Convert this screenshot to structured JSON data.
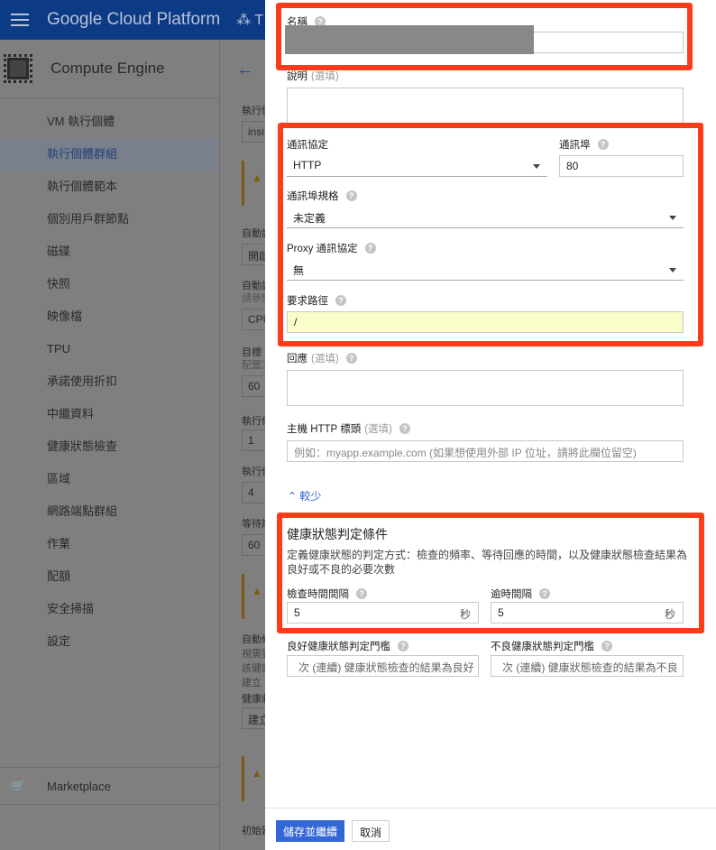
{
  "header": {
    "title": "Google Cloud Platform",
    "project": "T"
  },
  "sidebar": {
    "product": "Compute Engine",
    "items": [
      {
        "label": "VM 執行個體"
      },
      {
        "label": "執行個體群組",
        "selected": true
      },
      {
        "label": "執行個體範本"
      },
      {
        "label": "個別用戶群節點"
      },
      {
        "label": "磁碟"
      },
      {
        "label": "快照"
      },
      {
        "label": "映像檔"
      },
      {
        "label": "TPU"
      },
      {
        "label": "承諾使用折扣"
      },
      {
        "label": "中繼資料"
      },
      {
        "label": "健康狀態檢查"
      },
      {
        "label": "區域"
      },
      {
        "label": "網路端點群組"
      },
      {
        "label": "作業"
      },
      {
        "label": "配額"
      },
      {
        "label": "安全掃描"
      },
      {
        "label": "設定"
      }
    ],
    "marketplace": "Marketplace"
  },
  "background": {
    "labels": [
      "執行個",
      "自動調",
      "自動調",
      "請參閱",
      "目標",
      "配置工",
      "執行個",
      "執行個",
      "等待期",
      "自動修",
      "視需要",
      "該健康",
      "建立",
      "健康狀",
      "初始延"
    ],
    "values": [
      "insi",
      "開啟",
      "CPU",
      "60",
      "1",
      "4",
      "60",
      "建立"
    ]
  },
  "form": {
    "name": {
      "label": "名稱"
    },
    "description": {
      "label": "說明",
      "optional": "(選填)",
      "value": ""
    },
    "protocol": {
      "label": "通訊協定",
      "value": "HTTP"
    },
    "port": {
      "label": "通訊埠",
      "value": "80"
    },
    "port_spec": {
      "label": "通訊埠規格",
      "value": "未定義"
    },
    "proxy": {
      "label": "Proxy 通訊協定",
      "value": "無"
    },
    "path": {
      "label": "要求路徑",
      "value": "/"
    },
    "response": {
      "label": "回應",
      "optional": "(選填)",
      "value": ""
    },
    "host": {
      "label": "主機 HTTP 標頭",
      "optional": "(選填)",
      "placeholder": "例如：myapp.example.com (如果想使用外部 IP 位址，請將此欄位留空)"
    },
    "less": "較少",
    "criteria": {
      "title": "健康狀態判定條件",
      "desc": "定義健康狀態的判定方式：檢查的頻率、等待回應的時間，以及健康狀態檢查結果為良好或不良的必要次數"
    },
    "interval": {
      "label": "檢查時間間隔",
      "value": "5",
      "unit": "秒"
    },
    "timeout": {
      "label": "逾時間隔",
      "value": "5",
      "unit": "秒"
    },
    "healthy": {
      "label": "良好健康狀態判定門檻",
      "placeholder": "次 (連續) 健康狀態檢查的結果為良好"
    },
    "unhealthy": {
      "label": "不良健康狀態判定門檻",
      "placeholder": "次 (連續) 健康狀態檢查的結果為不良"
    }
  },
  "footer": {
    "save": "儲存並繼續",
    "cancel": "取消"
  },
  "colors": {
    "annotation": "#ff3b1a",
    "primary": "#3367d6",
    "path_bg": "#fafcc9"
  }
}
